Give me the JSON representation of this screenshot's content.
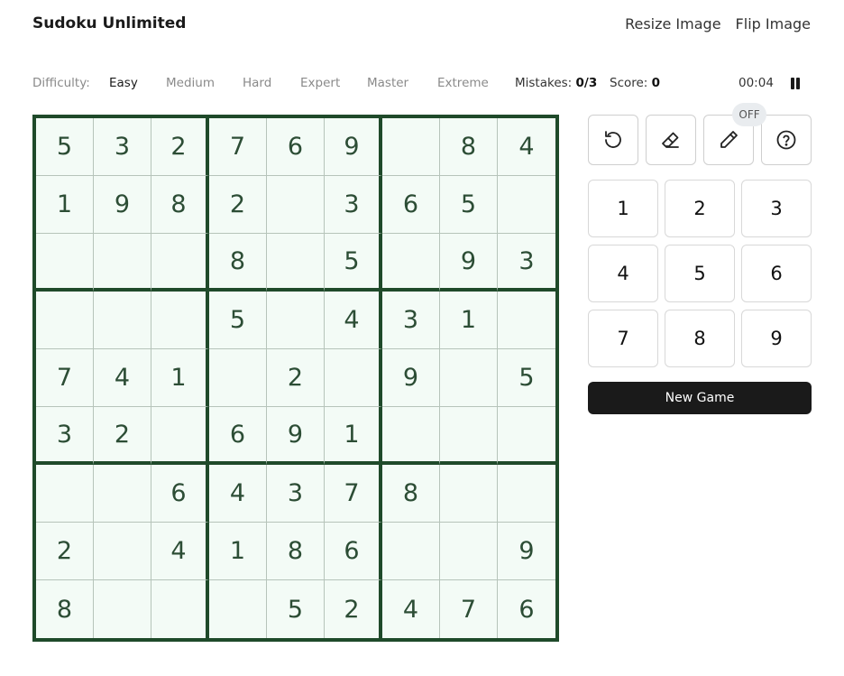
{
  "header": {
    "title": "Sudoku Unlimited",
    "links": [
      "Resize Image",
      "Flip Image"
    ]
  },
  "toolbar": {
    "difficulty_label": "Difficulty:",
    "difficulties": [
      "Easy",
      "Medium",
      "Hard",
      "Expert",
      "Master",
      "Extreme"
    ],
    "selected_difficulty": "Easy",
    "mistakes_label": "Mistakes:",
    "mistakes_value": "0/3",
    "score_label": "Score:",
    "score_value": "0",
    "timer": "00:04",
    "pause_icon": "pause-icon"
  },
  "board": {
    "grid": [
      [
        "5",
        "3",
        "2",
        "7",
        "6",
        "9",
        "",
        "8",
        "4"
      ],
      [
        "1",
        "9",
        "8",
        "2",
        "",
        "3",
        "6",
        "5",
        ""
      ],
      [
        "",
        "",
        "",
        "8",
        "",
        "5",
        "",
        "9",
        "3"
      ],
      [
        "",
        "",
        "",
        "5",
        "",
        "4",
        "3",
        "1",
        ""
      ],
      [
        "7",
        "4",
        "1",
        "",
        "2",
        "",
        "9",
        "",
        "5"
      ],
      [
        "3",
        "2",
        "",
        "6",
        "9",
        "1",
        "",
        "",
        ""
      ],
      [
        "",
        "",
        "6",
        "4",
        "3",
        "7",
        "8",
        "",
        ""
      ],
      [
        "2",
        "",
        "4",
        "1",
        "8",
        "6",
        "",
        "",
        "9"
      ],
      [
        "8",
        "",
        "",
        "",
        "5",
        "2",
        "4",
        "7",
        "6"
      ]
    ]
  },
  "tools": {
    "icons": [
      "undo-icon",
      "eraser-icon",
      "pencil-icon",
      "hint-icon"
    ],
    "notes_badge": "OFF"
  },
  "numpad": [
    "1",
    "2",
    "3",
    "4",
    "5",
    "6",
    "7",
    "8",
    "9"
  ],
  "actions": {
    "new_game": "New Game"
  },
  "colors": {
    "board_border": "#1f4a2a",
    "cell_bg": "#f3fbf6",
    "digit": "#2c4d35",
    "button_dark": "#1a1a1a"
  }
}
